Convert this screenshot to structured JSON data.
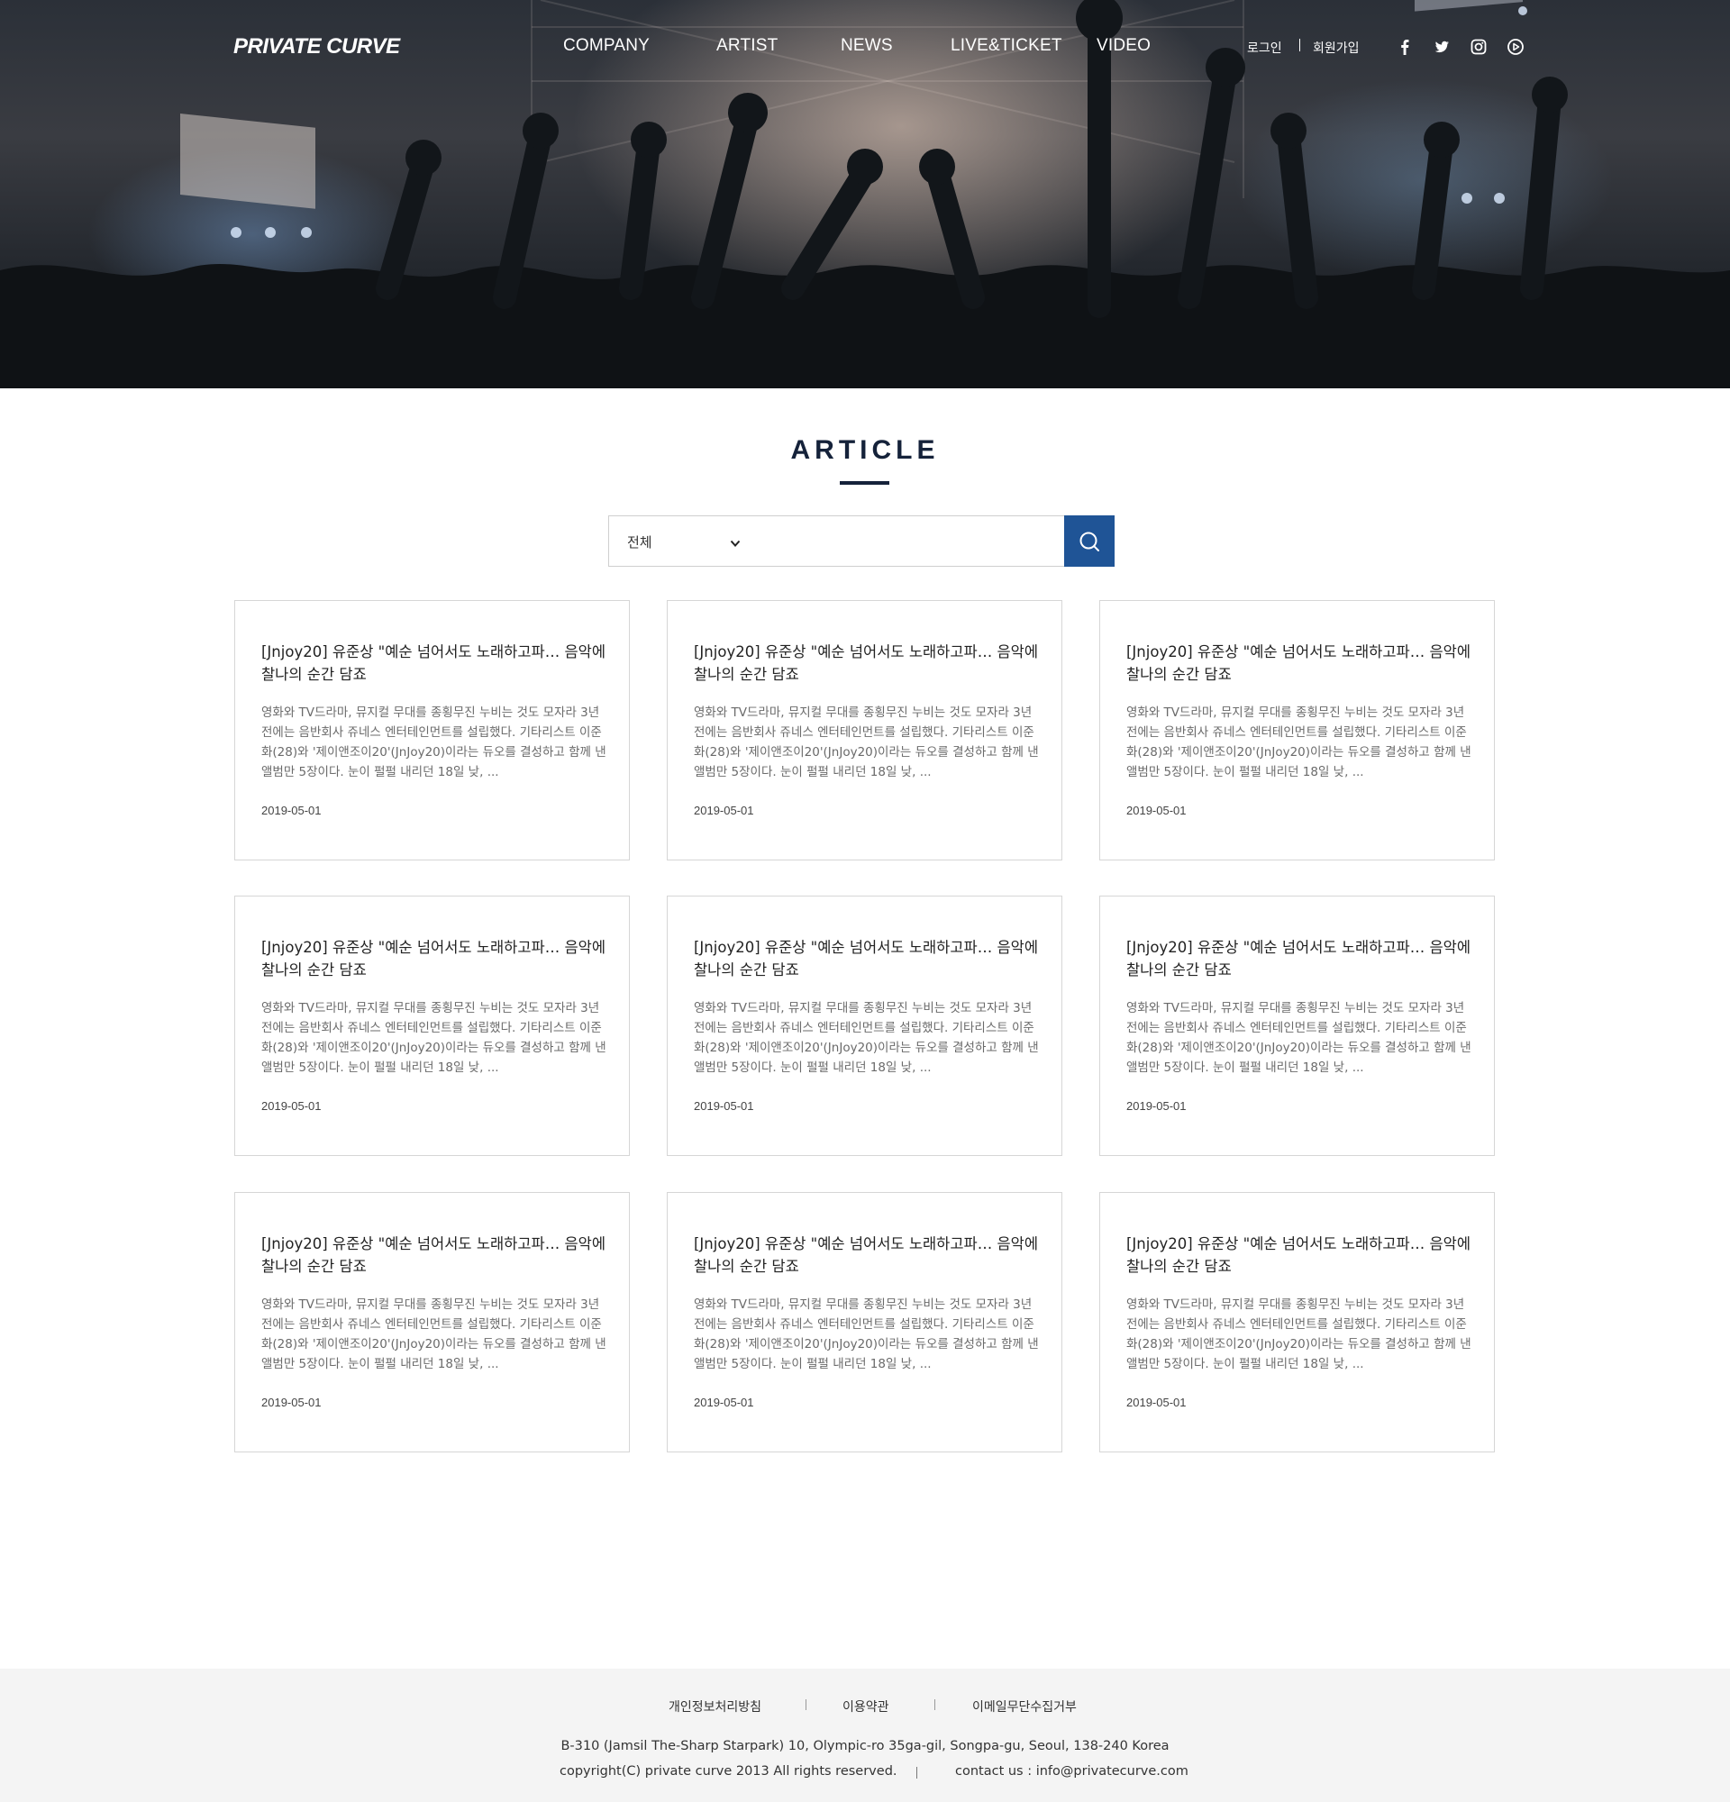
{
  "header": {
    "logo": "PRIVATE CURVE",
    "nav": [
      "COMPANY",
      "ARTIST",
      "NEWS",
      "LIVE&TICKET",
      "VIDEO"
    ],
    "login": "로그인",
    "signup": "회원가입",
    "sns_icons": [
      "facebook-icon",
      "twitter-icon",
      "instagram-icon",
      "play-icon"
    ]
  },
  "page": {
    "title": "ARTICLE"
  },
  "search": {
    "category_selected": "전체",
    "query": "",
    "button_icon": "search-icon",
    "accent_color": "#1f5496"
  },
  "articles": [
    {
      "title": "[Jnjoy20] 유준상 \"예순 넘어서도 노래하고파… 음악에 찰나의 순간 담죠",
      "summary": "영화와 TV드라마, 뮤지컬 무대를 종횡무진 누비는 것도 모자라 3년 전에는 음반회사 쥬네스 엔터테인먼트를 설립했다. 기타리스트 이준화(28)와 '제이앤조이20'(JnJoy20)이라는 듀오를 결성하고 함께 낸 앨범만 5장이다. 눈이 펄펄 내리던 18일 낮, ...",
      "date": "2019-05-01"
    },
    {
      "title": "[Jnjoy20] 유준상 \"예순 넘어서도 노래하고파… 음악에 찰나의 순간 담죠",
      "summary": "영화와 TV드라마, 뮤지컬 무대를 종횡무진 누비는 것도 모자라 3년 전에는 음반회사 쥬네스 엔터테인먼트를 설립했다. 기타리스트 이준화(28)와 '제이앤조이20'(JnJoy20)이라는 듀오를 결성하고 함께 낸 앨범만 5장이다. 눈이 펄펄 내리던 18일 낮, ...",
      "date": "2019-05-01"
    },
    {
      "title": "[Jnjoy20] 유준상 \"예순 넘어서도 노래하고파… 음악에 찰나의 순간 담죠",
      "summary": "영화와 TV드라마, 뮤지컬 무대를 종횡무진 누비는 것도 모자라 3년 전에는 음반회사 쥬네스 엔터테인먼트를 설립했다. 기타리스트 이준화(28)와 '제이앤조이20'(JnJoy20)이라는 듀오를 결성하고 함께 낸 앨범만 5장이다. 눈이 펄펄 내리던 18일 낮, ...",
      "date": "2019-05-01"
    },
    {
      "title": "[Jnjoy20] 유준상 \"예순 넘어서도 노래하고파… 음악에 찰나의 순간 담죠",
      "summary": "영화와 TV드라마, 뮤지컬 무대를 종횡무진 누비는 것도 모자라 3년 전에는 음반회사 쥬네스 엔터테인먼트를 설립했다. 기타리스트 이준화(28)와 '제이앤조이20'(JnJoy20)이라는 듀오를 결성하고 함께 낸 앨범만 5장이다. 눈이 펄펄 내리던 18일 낮, ...",
      "date": "2019-05-01"
    },
    {
      "title": "[Jnjoy20] 유준상 \"예순 넘어서도 노래하고파… 음악에 찰나의 순간 담죠",
      "summary": "영화와 TV드라마, 뮤지컬 무대를 종횡무진 누비는 것도 모자라 3년 전에는 음반회사 쥬네스 엔터테인먼트를 설립했다. 기타리스트 이준화(28)와 '제이앤조이20'(JnJoy20)이라는 듀오를 결성하고 함께 낸 앨범만 5장이다. 눈이 펄펄 내리던 18일 낮, ...",
      "date": "2019-05-01"
    },
    {
      "title": "[Jnjoy20] 유준상 \"예순 넘어서도 노래하고파… 음악에 찰나의 순간 담죠",
      "summary": "영화와 TV드라마, 뮤지컬 무대를 종횡무진 누비는 것도 모자라 3년 전에는 음반회사 쥬네스 엔터테인먼트를 설립했다. 기타리스트 이준화(28)와 '제이앤조이20'(JnJoy20)이라는 듀오를 결성하고 함께 낸 앨범만 5장이다. 눈이 펄펄 내리던 18일 낮, ...",
      "date": "2019-05-01"
    },
    {
      "title": "[Jnjoy20] 유준상 \"예순 넘어서도 노래하고파… 음악에 찰나의 순간 담죠",
      "summary": "영화와 TV드라마, 뮤지컬 무대를 종횡무진 누비는 것도 모자라 3년 전에는 음반회사 쥬네스 엔터테인먼트를 설립했다. 기타리스트 이준화(28)와 '제이앤조이20'(JnJoy20)이라는 듀오를 결성하고 함께 낸 앨범만 5장이다. 눈이 펄펄 내리던 18일 낮, ...",
      "date": "2019-05-01"
    },
    {
      "title": "[Jnjoy20] 유준상 \"예순 넘어서도 노래하고파… 음악에 찰나의 순간 담죠",
      "summary": "영화와 TV드라마, 뮤지컬 무대를 종횡무진 누비는 것도 모자라 3년 전에는 음반회사 쥬네스 엔터테인먼트를 설립했다. 기타리스트 이준화(28)와 '제이앤조이20'(JnJoy20)이라는 듀오를 결성하고 함께 낸 앨범만 5장이다. 눈이 펄펄 내리던 18일 낮, ...",
      "date": "2019-05-01"
    },
    {
      "title": "[Jnjoy20] 유준상 \"예순 넘어서도 노래하고파… 음악에 찰나의 순간 담죠",
      "summary": "영화와 TV드라마, 뮤지컬 무대를 종횡무진 누비는 것도 모자라 3년 전에는 음반회사 쥬네스 엔터테인먼트를 설립했다. 기타리스트 이준화(28)와 '제이앤조이20'(JnJoy20)이라는 듀오를 결성하고 함께 낸 앨범만 5장이다. 눈이 펄펄 내리던 18일 낮, ...",
      "date": "2019-05-01"
    }
  ],
  "footer": {
    "links": [
      "개인정보처리방침",
      "이용약관",
      "이메일무단수집거부"
    ],
    "address": "B-310 (Jamsil The-Sharp Starpark) 10, Olympic-ro 35ga-gil, Songpa-gu, Seoul, 138-240 Korea",
    "copyright": "copyright(C) private curve 2013 All rights reserved.",
    "contact": "contact us : info@privatecurve.com"
  }
}
